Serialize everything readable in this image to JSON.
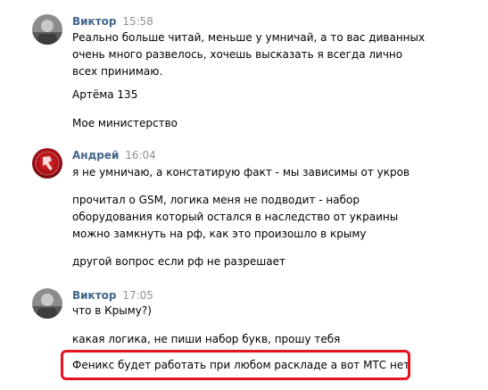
{
  "messages": [
    {
      "author": "Виктор",
      "time": "15:58",
      "avatar_icon": "user-photo-icon",
      "paragraphs": [
        [
          "Реально больше читай, меньше у умничай, а то вас диванных",
          "очень много развелось, хочешь высказать я всегда лично",
          "всех принимаю."
        ],
        [
          "Артёма 135"
        ],
        [
          "Мое министерство"
        ]
      ]
    },
    {
      "author": "Андрей",
      "time": "16:04",
      "avatar_icon": "red-emblem-icon",
      "paragraphs": [
        [
          "я не умничаю, а констатирую факт - мы зависимы от укров"
        ],
        [
          "прочитал о GSM, логика меня не подводит - набор",
          "оборудования который остался в наследство от украины",
          "можно замкнуть на рф, как это произошло в крыму"
        ],
        [
          "другой вопрос если рф не разрешает"
        ]
      ]
    },
    {
      "author": "Виктор",
      "time": "17:05",
      "avatar_icon": "user-photo-icon",
      "paragraphs": [
        [
          "что в Крыму?)"
        ],
        [
          "какая логика, не пиши набор букв, прошу тебя"
        ],
        [
          "Феникс будет работать при любом раскладе а вот МТС нет"
        ]
      ]
    }
  ],
  "colors": {
    "author": "#42648b",
    "time": "#939393",
    "highlight": "#e6141e"
  }
}
